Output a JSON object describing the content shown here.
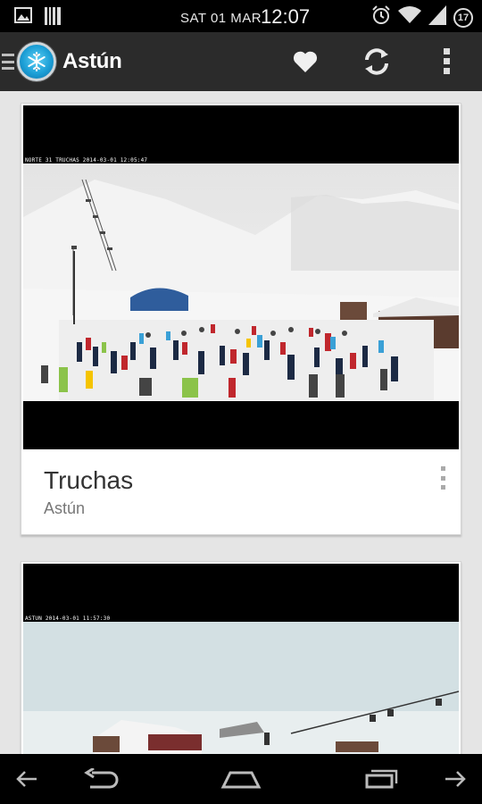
{
  "status_bar": {
    "date": "SAT 01 MAR",
    "time": "12:07",
    "notification_count": "17",
    "icons": [
      "image-icon",
      "barcode-icon",
      "alarm-icon",
      "wifi-icon",
      "signal-icon"
    ]
  },
  "action_bar": {
    "title": "Astún",
    "actions": [
      "favorite-icon",
      "refresh-icon",
      "overflow-menu-icon"
    ]
  },
  "webcams": [
    {
      "title": "Truchas",
      "subtitle": "Astún",
      "stamp": "NORTE 31 TRUCHAS 2014-03-01 12:05:47"
    },
    {
      "title": "",
      "subtitle": "",
      "stamp": "ASTUN 2014-03-01 11:57:30"
    }
  ],
  "nav_bar": {
    "buttons": [
      "left-arrow-icon",
      "back-icon",
      "home-icon",
      "recent-apps-icon",
      "right-arrow-icon"
    ]
  },
  "colors": {
    "action_bar_bg": "#2b2b2b",
    "content_bg": "#e5e5e5",
    "card_bg": "#ffffff",
    "title_text": "#333333",
    "subtitle_text": "#777777"
  }
}
